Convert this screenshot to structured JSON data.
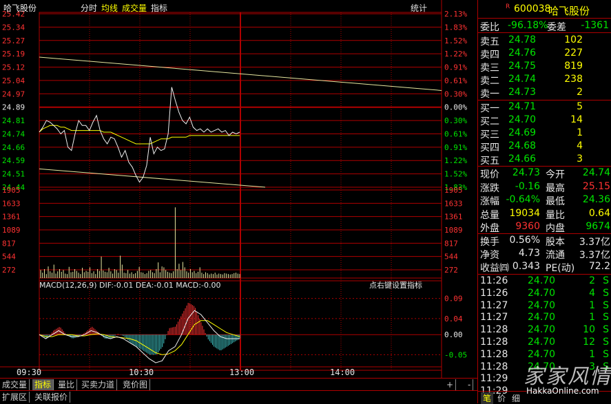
{
  "header": {
    "stock_name": "哈飞股份",
    "menu": [
      "分时",
      "均线",
      "成交量",
      "指标"
    ],
    "stats_label": "统计"
  },
  "colors": {
    "up": "#ff3232",
    "down": "#00e600",
    "neutral": "#c0c0c0",
    "avg": "#ffff00",
    "grid": "#b00000"
  },
  "chart_data": [
    {
      "type": "line",
      "name": "intraday-price",
      "yticks_left": [
        "25.42",
        "25.34",
        "25.27",
        "25.19",
        "25.12",
        "25.04",
        "24.97",
        "24.89",
        "24.81",
        "24.74",
        "24.66",
        "24.59",
        "24.51",
        "24.44"
      ],
      "yticks_right": [
        "2.13%",
        "1.83%",
        "1.52%",
        "1.22%",
        "0.91%",
        "0.61%",
        "0.30%",
        "0.00%",
        "0.30%",
        "0.61%",
        "0.91%",
        "1.22%",
        "1.52%",
        "1.83%"
      ],
      "ylim": [
        24.4,
        25.44
      ],
      "prev_close": 24.89,
      "xticks": [
        "09:30",
        "10:30",
        "13:00",
        "14:00"
      ],
      "x_minutes": [
        0,
        5,
        10,
        14,
        18,
        22,
        27,
        30,
        35,
        40,
        42,
        45,
        50,
        55,
        58,
        62,
        65,
        68,
        72,
        76,
        80,
        84,
        87,
        89,
        90,
        92,
        96,
        100,
        105,
        110,
        115,
        120,
        125,
        130,
        135,
        140,
        145,
        150,
        155,
        160,
        165,
        170,
        175,
        180,
        185,
        190,
        195,
        200,
        205,
        210,
        215,
        220,
        225,
        230,
        235,
        240
      ],
      "price": [
        24.73,
        24.76,
        24.8,
        24.79,
        24.77,
        24.75,
        24.72,
        24.74,
        24.64,
        24.62,
        24.72,
        24.8,
        24.77,
        24.77,
        24.74,
        24.79,
        24.83,
        24.74,
        24.69,
        24.66,
        24.7,
        24.69,
        24.64,
        24.58,
        24.62,
        24.55,
        24.52,
        24.47,
        24.43,
        24.46,
        24.53,
        24.7,
        24.6,
        24.64,
        24.62,
        24.63,
        24.72,
        25.0,
        24.92,
        24.85,
        24.8,
        24.78,
        24.82,
        24.76,
        24.74,
        24.75,
        24.73,
        24.75,
        24.73,
        24.74,
        24.75,
        24.73,
        24.74,
        24.71,
        24.73,
        24.72,
        24.73
      ],
      "avg": [
        24.73,
        24.75,
        24.76,
        24.77,
        24.77,
        24.77,
        24.76,
        24.76,
        24.75,
        24.74,
        24.74,
        24.74,
        24.74,
        24.74,
        24.74,
        24.74,
        24.74,
        24.74,
        24.73,
        24.73,
        24.73,
        24.72,
        24.71,
        24.7,
        24.69,
        24.68,
        24.67,
        24.66,
        24.66,
        24.66,
        24.66,
        24.66,
        24.67,
        24.68,
        24.69,
        24.69,
        24.69,
        24.7,
        24.7,
        24.7,
        24.7,
        24.7,
        24.71,
        24.71,
        24.71,
        24.71,
        24.71,
        24.71,
        24.71,
        24.71,
        24.71,
        24.71,
        24.71,
        24.71,
        24.71,
        24.71,
        24.71
      ],
      "trend_upper": [
        25.18,
        24.98
      ],
      "trend_lower": [
        24.51,
        24.4
      ]
    },
    {
      "type": "bar",
      "name": "volume",
      "yticks": [
        "1905",
        "1633",
        "1361",
        "1089",
        "817",
        "544",
        "272"
      ],
      "ylim": [
        0,
        2000
      ],
      "volume": [
        180,
        120,
        200,
        90,
        260,
        150,
        120,
        300,
        100,
        150,
        200,
        140,
        180,
        100,
        90,
        250,
        130,
        140,
        200,
        160,
        120,
        90,
        230,
        130,
        160,
        140,
        240,
        110,
        150,
        90,
        200,
        160,
        480,
        170,
        140,
        130,
        230,
        150,
        100,
        200,
        180,
        120,
        500,
        300,
        120,
        110,
        180,
        100,
        130,
        90,
        110,
        160,
        250,
        130,
        120,
        90,
        110,
        160,
        180,
        130,
        110,
        200,
        350,
        130,
        260,
        240,
        180,
        140,
        120,
        110,
        150,
        1580,
        200,
        320,
        180,
        360,
        240,
        150,
        120,
        200,
        130,
        160,
        110,
        140,
        240,
        120,
        90,
        130,
        110,
        80,
        100,
        90,
        120,
        80,
        100,
        90,
        80,
        110,
        100,
        90,
        80,
        90,
        110,
        120,
        100,
        90
      ]
    },
    {
      "type": "line",
      "name": "macd",
      "title": "MACD(12,26,9) DIF:-0.01 DEA:-0.01 MACD:-0.00",
      "hint": "点右键设置指标",
      "yticks": [
        "0.09",
        "0.04",
        "0.00",
        "-0.05"
      ],
      "ylim": [
        -0.075,
        0.11
      ],
      "dif": [
        0.0,
        -0.01,
        0.0,
        0.01,
        0.0,
        -0.005,
        -0.005,
        0.0,
        0.01,
        0.005,
        -0.005,
        -0.01,
        -0.005,
        -0.01,
        -0.02,
        -0.03,
        -0.045,
        -0.06,
        -0.07,
        -0.065,
        -0.04,
        -0.03,
        0.0,
        0.04,
        0.06,
        0.05,
        0.03,
        0.01,
        -0.005,
        -0.01,
        -0.01,
        -0.01
      ],
      "dea": [
        0.0,
        -0.005,
        -0.005,
        0.0,
        0.0,
        0.0,
        -0.003,
        -0.003,
        0.0,
        0.002,
        0.0,
        -0.005,
        -0.006,
        -0.008,
        -0.01,
        -0.015,
        -0.025,
        -0.035,
        -0.045,
        -0.05,
        -0.048,
        -0.04,
        -0.025,
        0.0,
        0.025,
        0.035,
        0.035,
        0.025,
        0.015,
        0.005,
        0.0,
        -0.005
      ]
    }
  ],
  "quote": {
    "code": "600038",
    "name": "哈飞股份",
    "r_mark": "R",
    "wei_bi_label": "委比",
    "wei_bi": "-96.18%",
    "wei_cha_label": "委差",
    "wei_cha": "-1361",
    "sells": [
      {
        "label": "卖五",
        "price": "24.78",
        "vol": "102"
      },
      {
        "label": "卖四",
        "price": "24.76",
        "vol": "227"
      },
      {
        "label": "卖三",
        "price": "24.75",
        "vol": "819"
      },
      {
        "label": "卖二",
        "price": "24.74",
        "vol": "238"
      },
      {
        "label": "卖一",
        "price": "24.73",
        "vol": "2"
      }
    ],
    "buys": [
      {
        "label": "买一",
        "price": "24.71",
        "vol": "5"
      },
      {
        "label": "买二",
        "price": "24.70",
        "vol": "14"
      },
      {
        "label": "买三",
        "price": "24.69",
        "vol": "1"
      },
      {
        "label": "买四",
        "price": "24.68",
        "vol": "4"
      },
      {
        "label": "买五",
        "price": "24.66",
        "vol": "3"
      }
    ],
    "stats": [
      {
        "l1": "现价",
        "v1": "24.73",
        "c1": "green",
        "l2": "今开",
        "v2": "24.74",
        "c2": "green"
      },
      {
        "l1": "涨跌",
        "v1": "-0.16",
        "c1": "green",
        "l2": "最高",
        "v2": "25.15",
        "c2": "red"
      },
      {
        "l1": "涨幅",
        "v1": "-0.64%",
        "c1": "green",
        "l2": "最低",
        "v2": "24.36",
        "c2": "green"
      },
      {
        "l1": "总量",
        "v1": "19034",
        "c1": "yellow",
        "l2": "量比",
        "v2": "0.64",
        "c2": "yellow"
      },
      {
        "l1": "外盘",
        "v1": "9360",
        "c1": "red",
        "l2": "内盘",
        "v2": "9674",
        "c2": "green"
      }
    ],
    "fund": [
      {
        "l1": "换手",
        "v1": "0.56%",
        "l2": "股本",
        "v2": "3.37亿"
      },
      {
        "l1": "净资",
        "v1": "4.73",
        "l2": "流通",
        "v2": "3.37亿"
      },
      {
        "l1": "收益㈣",
        "v1": "0.343",
        "l2": "PE(动)",
        "v2": "72.2"
      }
    ],
    "ticks": [
      {
        "t": "11:26",
        "p": "24.70",
        "v": "2",
        "s": "S"
      },
      {
        "t": "11:26",
        "p": "24.70",
        "v": "4",
        "s": "S"
      },
      {
        "t": "11:27",
        "p": "24.70",
        "v": "1",
        "s": "S"
      },
      {
        "t": "11:27",
        "p": "24.70",
        "v": "1",
        "s": "S"
      },
      {
        "t": "11:28",
        "p": "24.70",
        "v": "10",
        "s": "S"
      },
      {
        "t": "11:28",
        "p": "24.70",
        "v": "12",
        "s": "S"
      },
      {
        "t": "11:28",
        "p": "24.70",
        "v": "1",
        "s": "S"
      },
      {
        "t": "11:28",
        "p": "24.70",
        "v": "3",
        "s": "S"
      },
      {
        "t": "11:29",
        "p": "",
        "v": "",
        "s": ""
      },
      {
        "t": "11:29",
        "p": "",
        "v": "",
        "s": ""
      }
    ],
    "bottom_tabs": [
      "笔",
      "价",
      "细"
    ]
  },
  "tabs": {
    "row1": [
      "成交量",
      "指标",
      "量比",
      "买卖力道",
      "竞价图"
    ],
    "row1_active": 1,
    "row2": [
      "扩展区",
      "关联报价"
    ],
    "scroll_plus": "+",
    "scroll_minus": "-"
  },
  "watermark": {
    "text": "家家风情",
    "url": "HakkaOnline.com"
  }
}
